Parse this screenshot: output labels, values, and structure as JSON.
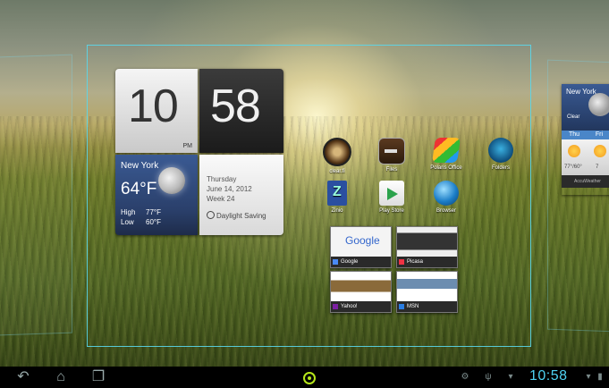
{
  "clock": {
    "hours": "10",
    "minutes": "58",
    "ampm": "PM"
  },
  "weather": {
    "city": "New York",
    "temp": "64°F",
    "high_label": "High",
    "high": "77°F",
    "low_label": "Low",
    "low": "60°F"
  },
  "date": {
    "weekday": "Thursday",
    "date": "June 14, 2012",
    "week": "Week 24",
    "dst": "Daylight Saving"
  },
  "apps": [
    {
      "label": "clear.fi",
      "icon": "clearfi-icon"
    },
    {
      "label": "Files",
      "icon": "files-icon"
    },
    {
      "label": "Polaris Office",
      "icon": "polaris-office-icon"
    },
    {
      "label": "Folders",
      "icon": "folders-icon"
    },
    {
      "label": "Zinio",
      "icon": "zinio-icon"
    },
    {
      "label": "Play Store",
      "icon": "play-store-icon"
    },
    {
      "label": "Browser",
      "icon": "browser-icon"
    }
  ],
  "bookmarks": [
    {
      "label": "Google",
      "thumb_text": "Google"
    },
    {
      "label": "Picasa"
    },
    {
      "label": "Yahoo!"
    },
    {
      "label": "MSN"
    }
  ],
  "right_widget": {
    "city": "New York",
    "status": "Clear",
    "day1": "Thu",
    "day2": "Fri",
    "temp1": "77°/60°",
    "temp2": "7",
    "provider": "AccuWeather"
  },
  "statusbar": {
    "time": "10:58"
  },
  "colors": {
    "workspace_border": "#5ad7eb",
    "home_accent": "#b6e61a",
    "status_clock": "#4fd2f2"
  }
}
